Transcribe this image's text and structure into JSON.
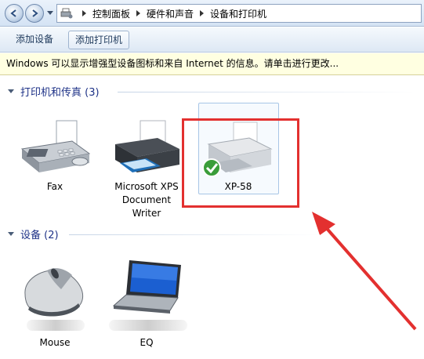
{
  "address": {
    "breadcrumbs": [
      "控制面板",
      "硬件和声音",
      "设备和打印机"
    ]
  },
  "toolbar": {
    "add_device_label": "添加设备",
    "add_printer_label": "添加打印机"
  },
  "infobar": {
    "text": "Windows 可以显示增强型设备图标和来自 Internet 的信息。请单击进行更改..."
  },
  "groups": {
    "printers": {
      "title": "打印机和传真 (3)",
      "items": [
        {
          "label": "Fax",
          "icon": "fax-icon"
        },
        {
          "label_lines": [
            "Microsoft XPS",
            "Document",
            "Writer"
          ],
          "icon": "printer-icon"
        },
        {
          "label": "XP-58",
          "icon": "printer-default-icon",
          "status": "default-printer-check"
        }
      ]
    },
    "devices": {
      "title": "设备 (2)",
      "items": [
        {
          "label": "Mouse",
          "icon": "mouse-icon"
        },
        {
          "label": "EQ",
          "icon": "laptop-icon"
        }
      ]
    }
  },
  "colors": {
    "highlight_box": "#e3302f",
    "arrow": "#e3302f",
    "group_title": "#1e3287",
    "infobar_bg": "#ffffe1"
  }
}
